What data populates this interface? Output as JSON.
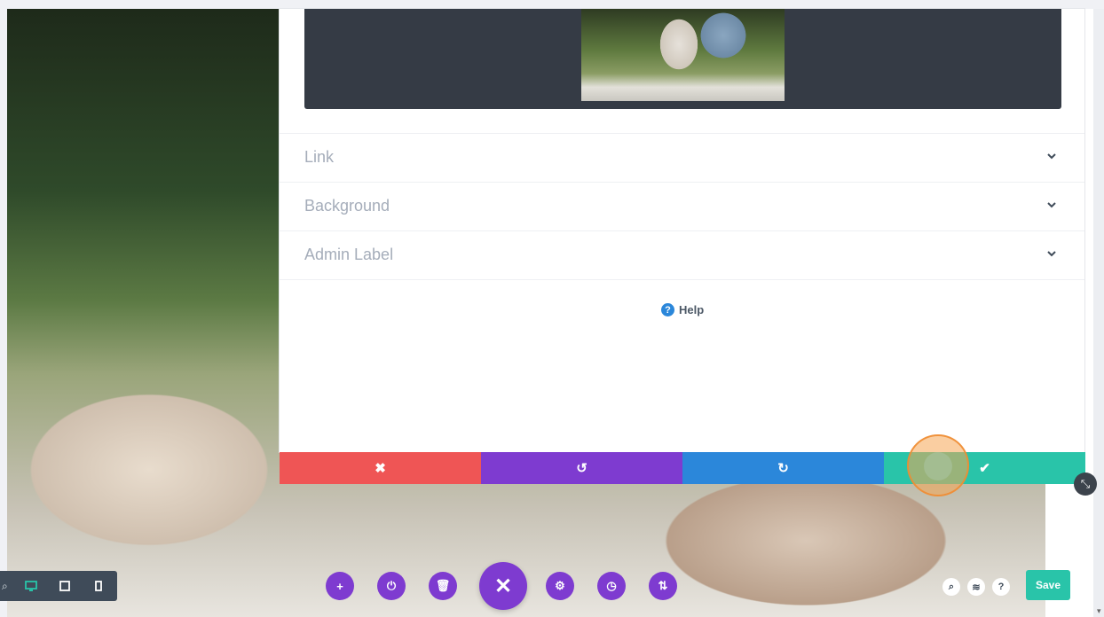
{
  "panel": {
    "accordions": [
      {
        "label": "Link"
      },
      {
        "label": "Background"
      },
      {
        "label": "Admin Label"
      }
    ],
    "help_label": "Help"
  },
  "action_bar": {
    "cancel_icon": "close-icon",
    "undo_icon": "undo-icon",
    "redo_icon": "redo-icon",
    "save_icon": "check-icon",
    "colors": {
      "cancel": "#ef5555",
      "undo": "#7e3bd0",
      "redo": "#2b87da",
      "save": "#29c4a9"
    }
  },
  "toolbar": {
    "buttons": [
      "add-icon",
      "power-icon",
      "trash-icon",
      "close-icon",
      "gear-icon",
      "history-icon",
      "sort-icon"
    ],
    "accent": "#7e3bd0"
  },
  "view_controls": [
    "desktop-icon",
    "tablet-icon",
    "phone-icon"
  ],
  "bottom_right": {
    "icons": [
      "search-icon",
      "layers-icon",
      "help-icon"
    ],
    "save_label": "Save"
  }
}
